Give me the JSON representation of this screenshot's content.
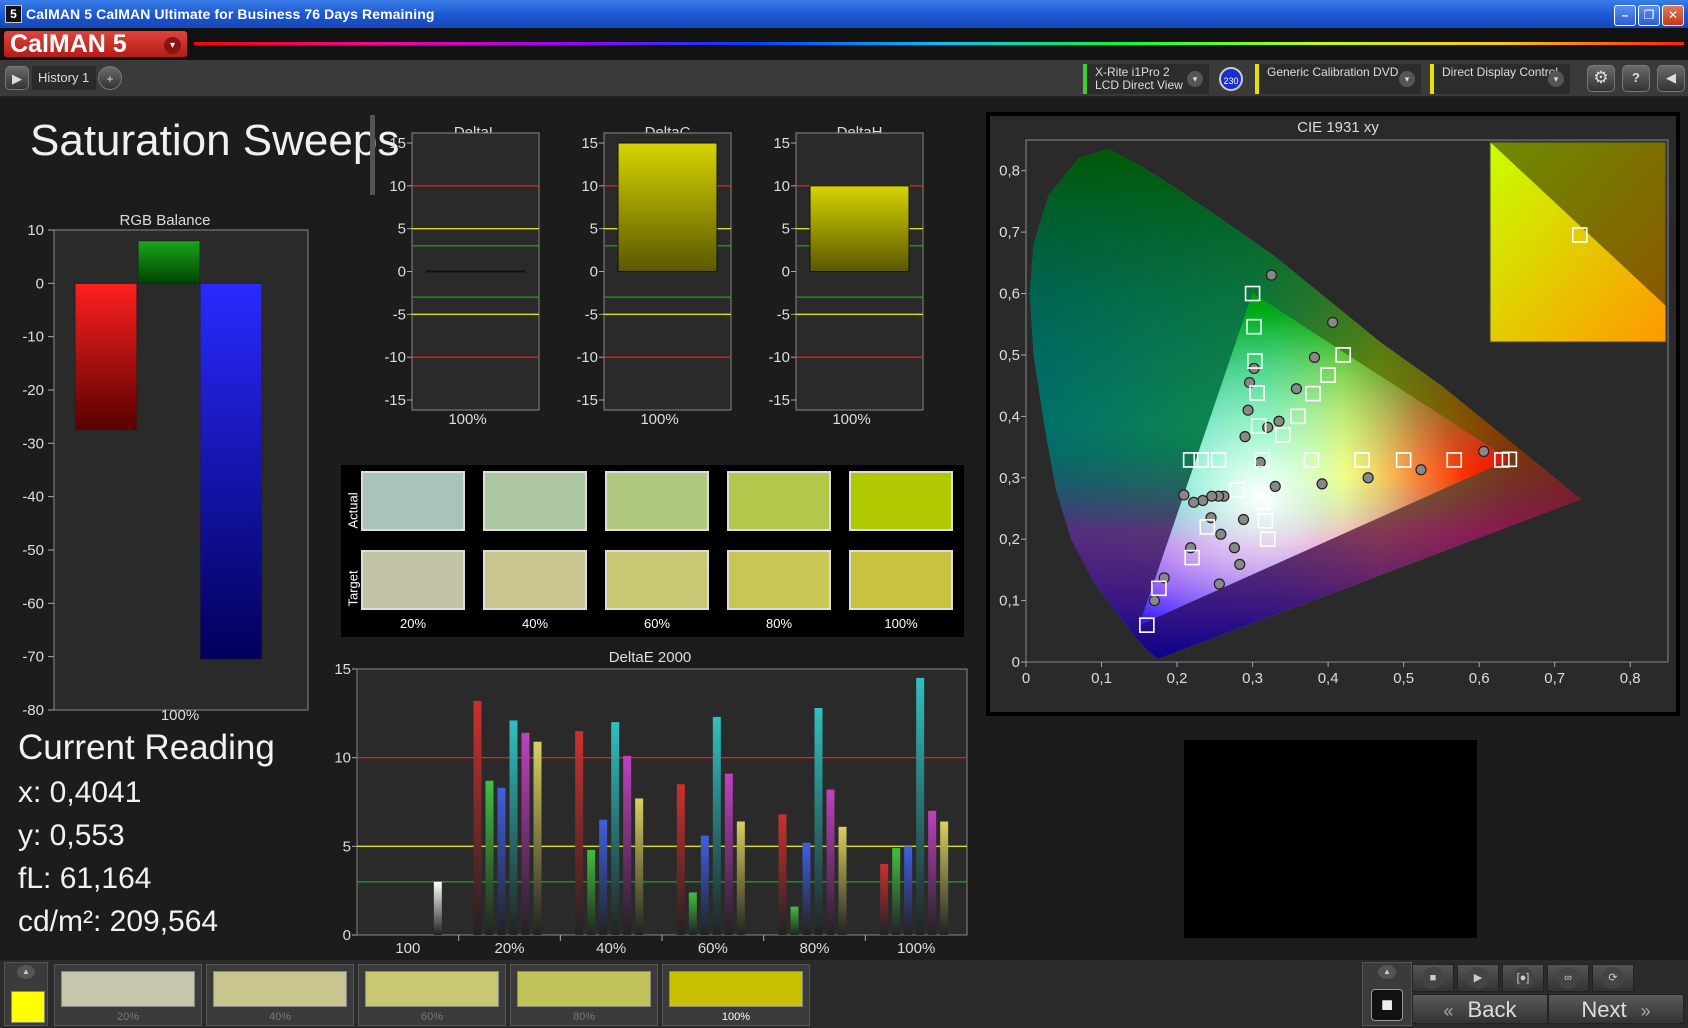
{
  "window": {
    "title": "CalMAN 5 CalMAN Ultimate for Business 76 Days Remaining",
    "icon_glyph": "5",
    "minimize_glyph": "–",
    "maximize_glyph": "❐",
    "close_glyph": "✕"
  },
  "app": {
    "logo": "CalMAN 5",
    "logo_arrow_glyph": "▾"
  },
  "tabs": {
    "items": [
      {
        "label": "History 1"
      }
    ],
    "add_glyph": "+",
    "play_glyph": "▶"
  },
  "devices": {
    "meter": {
      "line1": "X-Rite i1Pro 2",
      "line2": "LCD Direct View",
      "color": "#44cc33"
    },
    "meter_badge": "230",
    "source": {
      "label": "Generic Calibration DVD",
      "color": "#e8e000"
    },
    "display": {
      "label": "Direct Display Control",
      "color": "#e8e000"
    },
    "dropdown_glyph": "▾",
    "settings_glyph": "⚙",
    "help_glyph": "?",
    "collapse_glyph": "◀"
  },
  "page": {
    "title": "Saturation Sweeps"
  },
  "rgb_balance": {
    "title": "RGB Balance",
    "category": "100%",
    "ylim": [
      -80,
      10
    ],
    "ticks": [
      10,
      0,
      -10,
      -20,
      -30,
      -40,
      -50,
      -60,
      -70,
      -80
    ],
    "bars": [
      {
        "name": "Red",
        "value": -27.5,
        "color": "red"
      },
      {
        "name": "Green",
        "value": 8,
        "color": "green"
      },
      {
        "name": "Blue",
        "value": -70.5,
        "color": "blue"
      }
    ]
  },
  "delta_charts": [
    {
      "title": "DeltaL",
      "value": 0,
      "category": "100%"
    },
    {
      "title": "DeltaC",
      "value": 15,
      "category": "100%"
    },
    {
      "title": "DeltaH",
      "value": 10,
      "category": "100%"
    }
  ],
  "delta_ticks": [
    15,
    10,
    5,
    0,
    -5,
    -10,
    -15
  ],
  "swatches": {
    "actual_label": "Actual",
    "target_label": "Target",
    "labels": [
      "20%",
      "40%",
      "60%",
      "80%",
      "100%"
    ],
    "actual": [
      "#abc2bc",
      "#adc6a2",
      "#b1c880",
      "#b3c84a",
      "#afc800"
    ],
    "target": [
      "#c2c2a5",
      "#c8c58f",
      "#c9c774",
      "#c8c655",
      "#c8c23e"
    ]
  },
  "chart_data": [
    {
      "type": "bar",
      "title": "DeltaE 2000",
      "categories": [
        "100",
        "20%",
        "40%",
        "60%",
        "80%",
        "100%"
      ],
      "ylim": [
        0,
        15
      ],
      "ticks": [
        15,
        10,
        5,
        0
      ],
      "thresholds": [
        {
          "value": 10,
          "color": "#d22"
        },
        {
          "value": 5,
          "color": "#dd2"
        },
        {
          "value": 3,
          "color": "#292"
        }
      ],
      "series": [
        {
          "values": [
            null,
            13.2,
            11.5,
            8.5,
            6.8,
            4.0
          ],
          "color": "#cc3030"
        },
        {
          "values": [
            null,
            8.7,
            4.8,
            2.4,
            1.6,
            4.9
          ],
          "color": "#40c040"
        },
        {
          "values": [
            null,
            8.3,
            6.5,
            5.6,
            5.2,
            5.0
          ],
          "color": "#4060e0"
        },
        {
          "values": [
            null,
            12.1,
            12.0,
            12.3,
            12.8,
            14.5
          ],
          "color": "#30c0c0"
        },
        {
          "values": [
            null,
            11.4,
            10.1,
            9.1,
            8.2,
            7.0
          ],
          "color": "#c040c0"
        },
        {
          "values": [
            3.0,
            10.9,
            7.7,
            6.4,
            6.1,
            6.4
          ],
          "color": "#d8d060"
        }
      ],
      "white_bar": {
        "category": "100",
        "value": 3.0
      }
    },
    {
      "type": "scatter",
      "title": "CIE 1931 xy",
      "xlim": [
        0,
        0.85
      ],
      "ylim": [
        0,
        0.85
      ],
      "xticks": [
        "0",
        "0,1",
        "0,2",
        "0,3",
        "0,4",
        "0,5",
        "0,6",
        "0,7",
        "0,8"
      ],
      "yticks": [
        "0",
        "0,1",
        "0,2",
        "0,3",
        "0,4",
        "0,5",
        "0,6",
        "0,7",
        "0,8"
      ],
      "gamut": [
        [
          0.64,
          0.33
        ],
        [
          0.3,
          0.6
        ],
        [
          0.15,
          0.06
        ]
      ],
      "targets": [
        [
          0.313,
          0.329
        ],
        [
          0.3,
          0.6
        ],
        [
          0.302,
          0.546
        ],
        [
          0.303,
          0.49
        ],
        [
          0.306,
          0.438
        ],
        [
          0.308,
          0.384
        ],
        [
          0.255,
          0.329
        ],
        [
          0.232,
          0.329
        ],
        [
          0.218,
          0.329
        ],
        [
          0.63,
          0.329
        ],
        [
          0.567,
          0.329
        ],
        [
          0.5,
          0.329
        ],
        [
          0.445,
          0.329
        ],
        [
          0.378,
          0.329
        ],
        [
          0.64,
          0.33
        ],
        [
          0.32,
          0.2
        ],
        [
          0.317,
          0.23
        ],
        [
          0.314,
          0.26
        ],
        [
          0.176,
          0.12
        ],
        [
          0.16,
          0.06
        ],
        [
          0.22,
          0.17
        ],
        [
          0.24,
          0.22
        ],
        [
          0.28,
          0.28
        ],
        [
          0.42,
          0.5
        ],
        [
          0.4,
          0.467
        ],
        [
          0.38,
          0.437
        ],
        [
          0.36,
          0.4
        ],
        [
          0.34,
          0.37
        ]
      ],
      "measured": [
        [
          0.325,
          0.63
        ],
        [
          0.406,
          0.553
        ],
        [
          0.382,
          0.496
        ],
        [
          0.302,
          0.478
        ],
        [
          0.296,
          0.455
        ],
        [
          0.294,
          0.41
        ],
        [
          0.335,
          0.392
        ],
        [
          0.29,
          0.367
        ],
        [
          0.358,
          0.445
        ],
        [
          0.32,
          0.382
        ],
        [
          0.606,
          0.343
        ],
        [
          0.523,
          0.313
        ],
        [
          0.453,
          0.3
        ],
        [
          0.392,
          0.29
        ],
        [
          0.33,
          0.286
        ],
        [
          0.256,
          0.127
        ],
        [
          0.276,
          0.186
        ],
        [
          0.288,
          0.232
        ],
        [
          0.283,
          0.159
        ],
        [
          0.262,
          0.27
        ],
        [
          0.255,
          0.27
        ],
        [
          0.246,
          0.27
        ],
        [
          0.234,
          0.263
        ],
        [
          0.222,
          0.26
        ],
        [
          0.209,
          0.272
        ],
        [
          0.183,
          0.137
        ],
        [
          0.17,
          0.1
        ],
        [
          0.218,
          0.186
        ],
        [
          0.258,
          0.208
        ],
        [
          0.245,
          0.235
        ],
        [
          0.31,
          0.325
        ]
      ],
      "inset_target": [
        0.56,
        0.35
      ]
    }
  ],
  "reading": {
    "title": "Current Reading",
    "x": "x: 0,4041",
    "y": "y: 0,553",
    "fl": "fL: 61,164",
    "cdm2": "cd/m²: 209,564"
  },
  "bottom": {
    "current_color": "#ffff00",
    "up_glyph": "▲",
    "stop_big_glyph": "■",
    "thumbs": [
      {
        "label": "20%",
        "color": "#c6c6ad"
      },
      {
        "label": "40%",
        "color": "#c8c58f"
      },
      {
        "label": "60%",
        "color": "#c9c774"
      },
      {
        "label": "80%",
        "color": "#c2c25a"
      },
      {
        "label": "100%",
        "color": "#c8c000"
      }
    ],
    "controls": [
      "■",
      "▶",
      "[●]",
      "∞",
      "⟳"
    ],
    "back_label": "Back",
    "next_label": "Next",
    "back_glyph": "«",
    "next_glyph": "»"
  }
}
